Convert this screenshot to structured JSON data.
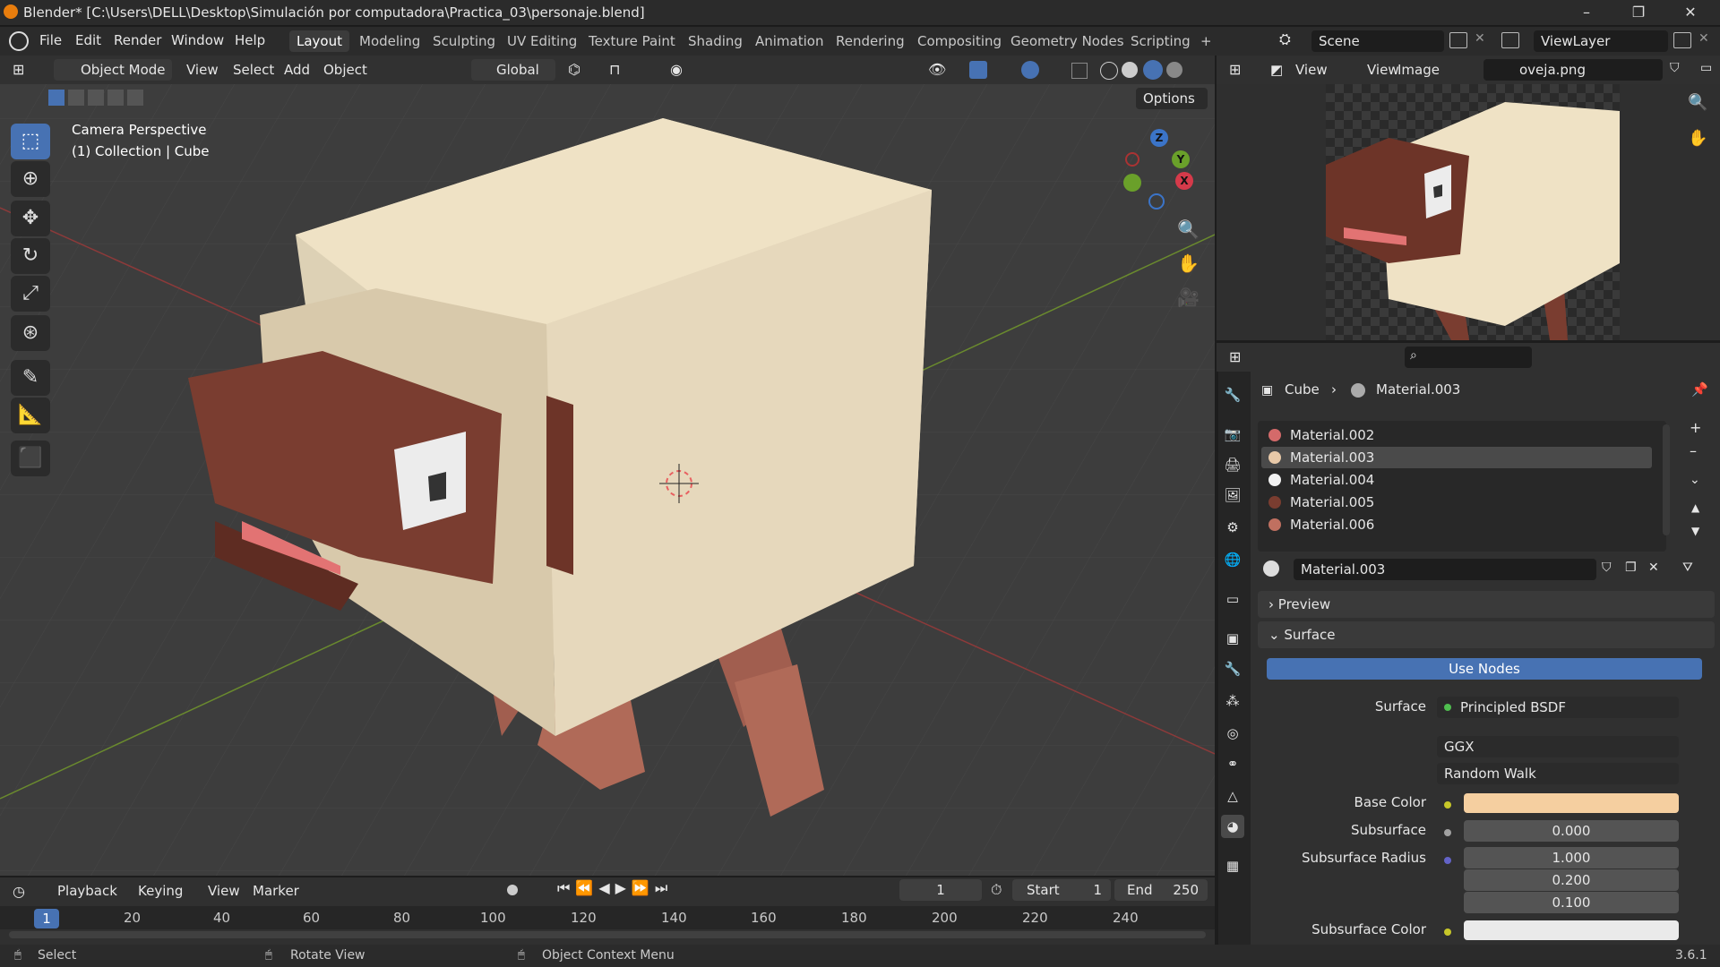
{
  "window": {
    "title": "Blender* [C:\\Users\\DELL\\Desktop\\Simulación por computadora\\Practica_03\\personaje.blend]",
    "minimize": "–",
    "maximize": "❐",
    "close": "✕"
  },
  "menu": [
    "File",
    "Edit",
    "Render",
    "Window",
    "Help"
  ],
  "workspaces": [
    "Layout",
    "Modeling",
    "Sculpting",
    "UV Editing",
    "Texture Paint",
    "Shading",
    "Animation",
    "Rendering",
    "Compositing",
    "Geometry Nodes",
    "Scripting"
  ],
  "add_workspace": "+",
  "scene": {
    "label": "Scene",
    "viewlayer": "ViewLayer"
  },
  "viewport": {
    "mode": "Object Mode",
    "menus": [
      "View",
      "Select",
      "Add",
      "Object"
    ],
    "transform_orientation": "Global",
    "options": "Options",
    "overlay_title": "Camera Perspective",
    "overlay_subtitle": "(1) Collection | Cube",
    "gizmo": {
      "z": "Z",
      "y": "Y",
      "x": "X"
    }
  },
  "image_editor": {
    "menus": [
      "View",
      "View",
      "Image"
    ],
    "image_name": "oveja.png"
  },
  "properties": {
    "breadcrumb_object": "Cube",
    "breadcrumb_material": "Material.003",
    "materials": [
      {
        "name": "Material.002",
        "color": "#d46a6a"
      },
      {
        "name": "Material.003",
        "color": "#e8c9a8"
      },
      {
        "name": "Material.004",
        "color": "#f2f2f2"
      },
      {
        "name": "Material.005",
        "color": "#7a3d30"
      },
      {
        "name": "Material.006",
        "color": "#c07060"
      }
    ],
    "selected_index": 1,
    "material_field": "Material.003",
    "preview_label": "Preview",
    "surface_label": "Surface",
    "use_nodes": "Use Nodes",
    "surface_field_label": "Surface",
    "surface_shader": "Principled BSDF",
    "distribution": "GGX",
    "subsurface_method": "Random Walk",
    "base_color_label": "Base Color",
    "base_color": "#f5cfa0",
    "subsurface_label": "Subsurface",
    "subsurface_value": "0.000",
    "subsurface_radius_label": "Subsurface Radius",
    "subsurface_radius": [
      "1.000",
      "0.200",
      "0.100"
    ],
    "subsurface_color_label": "Subsurface Color",
    "subsurface_color": "#eaeaea"
  },
  "timeline": {
    "menus": [
      "Playback",
      "Keying",
      "View",
      "Marker"
    ],
    "current_frame": "1",
    "start_label": "Start",
    "start_value": "1",
    "end_label": "End",
    "end_value": "250",
    "ticks": [
      "1",
      "20",
      "40",
      "60",
      "80",
      "100",
      "120",
      "140",
      "160",
      "180",
      "200",
      "220",
      "240"
    ]
  },
  "status_bar": {
    "select": "Select",
    "rotate": "Rotate View",
    "context": "Object Context Menu",
    "version": "3.6.1"
  }
}
